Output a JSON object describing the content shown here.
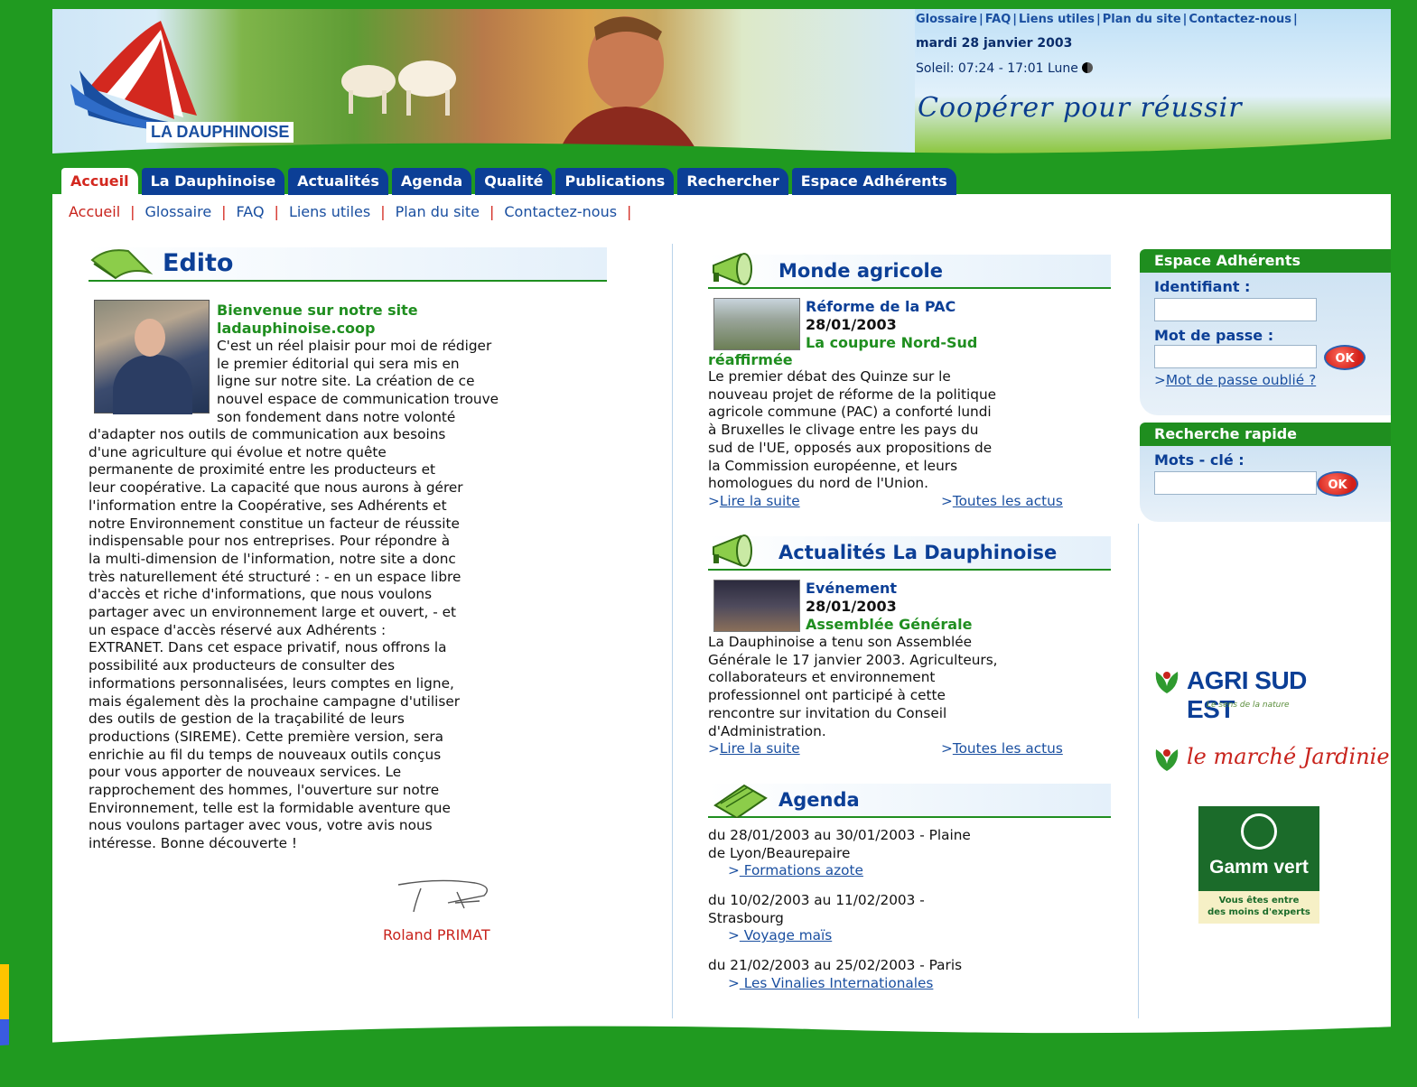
{
  "header": {
    "brand": "LA DAUPHINOISE",
    "top_links": [
      "Glossaire",
      "FAQ",
      "Liens utiles",
      "Plan du site",
      "Contactez-nous"
    ],
    "date": "mardi 28 janvier 2003",
    "sun": "Soleil: 07:24 - 17:01 Lune",
    "slogan": "Coopérer pour réussir"
  },
  "nav": {
    "tabs": [
      "Accueil",
      "La Dauphinoise",
      "Actualités",
      "Agenda",
      "Qualité",
      "Publications",
      "Rechercher",
      "Espace Adhérents"
    ],
    "active_tab": "Accueil",
    "sub_links": [
      "Accueil",
      "Glossaire",
      "FAQ",
      "Liens utiles",
      "Plan du site",
      "Contactez-nous"
    ]
  },
  "edito": {
    "title": "Edito",
    "heading_line1": "Bienvenue sur notre site",
    "heading_line2": "ladauphinoise.coop",
    "body_lines": [
      "C'est un réel plaisir pour moi de rédiger",
      "le premier éditorial qui sera mis en",
      "ligne sur notre site. La création de ce",
      "nouvel espace de communication trouve",
      "son fondement dans notre volonté",
      "d'adapter nos outils de communication aux besoins",
      "d'une agriculture qui évolue et notre quête",
      "permanente de proximité entre les producteurs et",
      "leur coopérative. La capacité que nous aurons à gérer",
      "l'information entre la Coopérative, ses Adhérents et",
      "notre Environnement constitue un facteur de réussite",
      "indispensable pour nos entreprises. Pour répondre à",
      "la multi-dimension de l'information, notre site a donc",
      "très naturellement été structuré : - en un espace libre",
      "d'accès et riche d'informations, que nous voulons",
      "partager avec un environnement large et ouvert, - et",
      "un espace d'accès réservé aux Adhérents :",
      "EXTRANET. Dans cet espace privatif, nous offrons la",
      "possibilité aux producteurs de consulter des",
      "informations personnalisées, leurs comptes en ligne,",
      "mais également dès la prochaine campagne d'utiliser",
      "des outils de gestion de la traçabilité de leurs",
      "productions (SIREME). Cette première version, sera",
      "enrichie au fil du temps de nouveaux outils conçus",
      "pour vous apporter de nouveaux services. Le",
      "rapprochement des hommes, l'ouverture sur notre",
      "Environnement, telle est la formidable aventure que",
      "nous voulons partager avec vous, votre avis nous",
      "intéresse. Bonne découverte !"
    ],
    "signature_name": "Roland PRIMAT"
  },
  "monde": {
    "title": "Monde agricole",
    "kind": "Réforme de la PAC",
    "date": "28/01/2003",
    "headline_a": "La coupure Nord-Sud",
    "headline_b": "réaffirmée",
    "text_lines": [
      "Le premier débat des Quinze sur le",
      "nouveau projet de réforme de la politique",
      "agricole commune (PAC) a conforté lundi",
      "à Bruxelles le clivage entre les pays du",
      "sud de l'UE, opposés aux propositions de",
      "la Commission européenne, et leurs",
      "homologues du nord de l'Union."
    ],
    "read_more": "Lire la suite",
    "all_news": "Toutes les actus"
  },
  "actus": {
    "title": "Actualités La Dauphinoise",
    "kind": "Evénement",
    "date": "28/01/2003",
    "headline": "Assemblée Générale",
    "text_lines": [
      "La Dauphinoise a tenu son Assemblée",
      "Générale le 17 janvier 2003. Agriculteurs,",
      "collaborateurs et environnement",
      "professionnel ont participé à cette",
      "rencontre sur invitation du Conseil",
      "d'Administration."
    ],
    "read_more": "Lire la suite",
    "all_news": "Toutes les actus"
  },
  "agenda": {
    "title": "Agenda",
    "items": [
      {
        "line1": "du 28/01/2003 au 30/01/2003 - Plaine",
        "line2": "de Lyon/Beaurepaire",
        "link": " Formations azote"
      },
      {
        "line1": "du 10/02/2003 au 11/02/2003 -",
        "line2": "Strasbourg",
        "link": " Voyage maïs"
      },
      {
        "line1": "du 21/02/2003 au 25/02/2003 - Paris",
        "line2": "",
        "link": " Les Vinalies Internationales"
      }
    ]
  },
  "members": {
    "title": "Espace Adhérents",
    "login_label": "Identifiant :",
    "login_value": "",
    "password_label": "Mot de passe :",
    "password_value": "",
    "ok": "OK",
    "forgot": "Mot de passe oublié ?"
  },
  "search": {
    "title": "Recherche rapide",
    "label": "Mots - clé :",
    "value": "",
    "ok": "OK"
  },
  "partners": {
    "agri_name": "AGRI SUD EST",
    "agri_tagline": "Le sens de la nature",
    "marche_name": "le marché Jardinier",
    "gamm_name": "Gamm vert",
    "gamm_tagline_1": "Vous êtes entre",
    "gamm_tagline_2": "des moins d'experts"
  },
  "colors": {
    "green": "#1f8e1f",
    "navy": "#0c3f96",
    "red": "#c8231c",
    "link_blue": "#1a4fa0"
  }
}
